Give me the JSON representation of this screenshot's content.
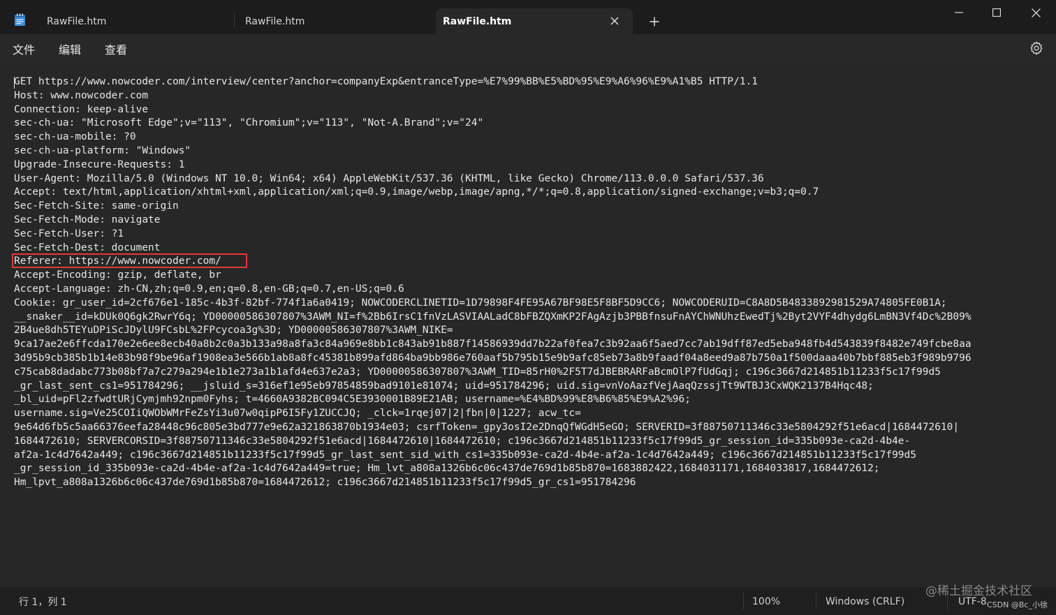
{
  "tabs": [
    {
      "label": "RawFile.htm",
      "active": false
    },
    {
      "label": "RawFile.htm",
      "active": false
    },
    {
      "label": "RawFile.htm",
      "active": true
    }
  ],
  "icons": {
    "app": "notepad-icon",
    "close_tab": "close-icon",
    "new_tab": "plus-icon",
    "minimize": "minimize-icon",
    "maximize": "maximize-icon",
    "close_window": "close-icon",
    "settings": "gear-icon"
  },
  "menu": {
    "file": "文件",
    "edit": "编辑",
    "view": "查看"
  },
  "editor": {
    "lines": [
      "GET https://www.nowcoder.com/interview/center?anchor=companyExp&entranceType=%E7%99%BB%E5%BD%95%E9%A6%96%E9%A1%B5 HTTP/1.1",
      "Host: www.nowcoder.com",
      "Connection: keep-alive",
      "sec-ch-ua: \"Microsoft Edge\";v=\"113\", \"Chromium\";v=\"113\", \"Not-A.Brand\";v=\"24\"",
      "sec-ch-ua-mobile: ?0",
      "sec-ch-ua-platform: \"Windows\"",
      "Upgrade-Insecure-Requests: 1",
      "User-Agent: Mozilla/5.0 (Windows NT 10.0; Win64; x64) AppleWebKit/537.36 (KHTML, like Gecko) Chrome/113.0.0.0 Safari/537.36",
      "Accept: text/html,application/xhtml+xml,application/xml;q=0.9,image/webp,image/apng,*/*;q=0.8,application/signed-exchange;v=b3;q=0.7",
      "Sec-Fetch-Site: same-origin",
      "Sec-Fetch-Mode: navigate",
      "Sec-Fetch-User: ?1",
      "Sec-Fetch-Dest: document",
      "Referer: https://www.nowcoder.com/",
      "Accept-Encoding: gzip, deflate, br",
      "Accept-Language: zh-CN,zh;q=0.9,en;q=0.8,en-GB;q=0.7,en-US;q=0.6",
      "Cookie: gr_user_id=2cf676e1-185c-4b3f-82bf-774f1a6a0419; NOWCODERCLINETID=1D79898F4FE95A67BF98E5F8BF5D9CC6; NOWCODERUID=C8A8D5B4833892981529A74805FE0B1A;",
      "__snaker__id=kDUk0Q6gk2RwrY6q; YD00000586307807%3AWM_NI=f%2Bb6IrsC1fnVzLASVIAALadC8bFBZQXmKP2FAgAzjb3PBBfnsuFnAYChWNUhzEwedTj%2Byt2VYF4dhydg6LmBN3Vf4Dc%2B09%",
      "2B4ue8dh5TEYuDPiScJDylU9FCsbL%2FPcycoa3g%3D; YD00000586307807%3AWM_NIKE=",
      "9ca17ae2e6ffcda170e2e6ee8ecb40a8b2c0a3b133a98a8fa3c84a969e8bb1c843ab91b887f14586939dd7b22af0fea7c3b92aa6f5aed7cc7ab19dff87ed5eba948fb4d543839f8482e749fcbe8aa",
      "3d95b9cb385b1b14e83b98f9be96af1908ea3e566b1ab8a8fc45381b899afd864ba9bb986e760aaf5b795b15e9b9afc85eb73a8b9faadf04a8eed9a87b750a1f500daaa40b7bbf885eb3f989b9796",
      "c75cab8dadabc773b08bf7a7c279a294e1b1e273a1b1afd4e637e2a3; YD00000586307807%3AWM_TID=85rH0%2F5T7dJBEBRARFaBcmOlP7fUdGqj; c196c3667d214851b11233f5c17f99d5",
      "_gr_last_sent_cs1=951784296; __jsluid_s=316ef1e95eb97854859bad9101e81074; uid=951784296; uid.sig=vnVoAazfVejAaqQzssjTt9WTBJ3CxWQK2137B4Hqc48;",
      "_bl_uid=pFl2zfwdtURjCymjmh92npm0Fyhs; t=4660A9382BC094C5E3930001B89E21AB; username=%E4%BD%99%E8%B6%85%E9%A2%96;",
      "username.sig=Ve25COIiQWObWMrFeZsYi3u07w0qipP6I5Fy1ZUCCJQ; _clck=1rqej07|2|fbn|0|1227; acw_tc=",
      "9e64d6fb5c5aa66376eefa28448c96c805e3bd777e9e62a321863870b1934e03; csrfToken=_gpy3osI2e2DnqQfWGdH5eGO; SERVERID=3f88750711346c33e5804292f51e6acd|1684472610|",
      "1684472610; SERVERCORSID=3f88750711346c33e5804292f51e6acd|1684472610|1684472610; c196c3667d214851b11233f5c17f99d5_gr_session_id=335b093e-ca2d-4b4e-",
      "af2a-1c4d7642a449; c196c3667d214851b11233f5c17f99d5_gr_last_sent_sid_with_cs1=335b093e-ca2d-4b4e-af2a-1c4d7642a449; c196c3667d214851b11233f5c17f99d5",
      "_gr_session_id_335b093e-ca2d-4b4e-af2a-1c4d7642a449=true; Hm_lvt_a808a1326b6c06c437de769d1b85b870=1683882422,1684031171,1684033817,1684472612;",
      "Hm_lpvt_a808a1326b6c06c437de769d1b85b870=1684472612; c196c3667d214851b11233f5c17f99d5_gr_cs1=951784296"
    ]
  },
  "status": {
    "position": "行 1，列 1",
    "zoom": "100%",
    "line_ending": "Windows (CRLF)",
    "encoding": "UTF-8"
  },
  "watermark": {
    "site": "@稀土掘金技术社区",
    "author": "CSDN @Bc_小徐"
  },
  "colors": {
    "highlight_box": "#e53935",
    "editor_bg": "#272727"
  }
}
